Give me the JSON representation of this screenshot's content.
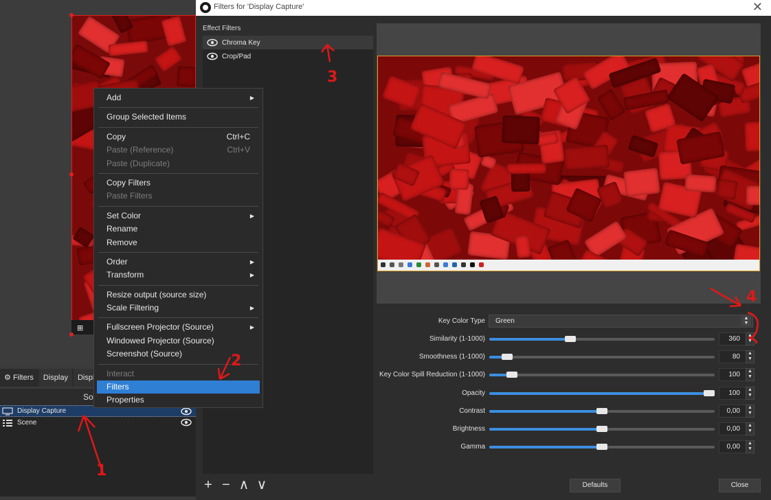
{
  "main": {
    "dock_tabs": [
      "Filters",
      "Display",
      "Displ"
    ],
    "sources_header": "Sou",
    "sources": [
      {
        "name": "Display Capture",
        "selected": true
      },
      {
        "name": "Scene",
        "selected": false
      }
    ]
  },
  "context_menu": {
    "items": [
      {
        "label": "Add",
        "submenu": true
      },
      {
        "sep": true
      },
      {
        "label": "Group Selected Items"
      },
      {
        "sep": true
      },
      {
        "label": "Copy",
        "shortcut": "Ctrl+C"
      },
      {
        "label": "Paste (Reference)",
        "shortcut": "Ctrl+V",
        "disabled": true
      },
      {
        "label": "Paste (Duplicate)",
        "disabled": true
      },
      {
        "sep": true
      },
      {
        "label": "Copy Filters"
      },
      {
        "label": "Paste Filters",
        "disabled": true
      },
      {
        "sep": true
      },
      {
        "label": "Set Color",
        "submenu": true
      },
      {
        "label": "Rename"
      },
      {
        "label": "Remove"
      },
      {
        "sep": true
      },
      {
        "label": "Order",
        "submenu": true
      },
      {
        "label": "Transform",
        "submenu": true
      },
      {
        "sep": true
      },
      {
        "label": "Resize output (source size)"
      },
      {
        "label": "Scale Filtering",
        "submenu": true
      },
      {
        "sep": true
      },
      {
        "label": "Fullscreen Projector (Source)",
        "submenu": true
      },
      {
        "label": "Windowed Projector (Source)"
      },
      {
        "label": "Screenshot (Source)"
      },
      {
        "sep": true
      },
      {
        "label": "Interact",
        "disabled": true
      },
      {
        "label": "Filters",
        "highlighted": true
      },
      {
        "label": "Properties"
      }
    ]
  },
  "dialog": {
    "title": "Filters for 'Display Capture'",
    "effect_filters_label": "Effect Filters",
    "filters": [
      {
        "name": "Chroma Key",
        "selected": true
      },
      {
        "name": "Crop/Pad",
        "selected": false
      }
    ],
    "list_tools": [
      "+",
      "−",
      "∧",
      "∨"
    ],
    "key_color_type": {
      "label": "Key Color Type",
      "value": "Green"
    },
    "properties": [
      {
        "label": "Similarity (1-1000)",
        "value": "360",
        "fraction": 0.36
      },
      {
        "label": "Smoothness (1-1000)",
        "value": "80",
        "fraction": 0.08
      },
      {
        "label": "Key Color Spill Reduction (1-1000)",
        "value": "100",
        "fraction": 0.1
      },
      {
        "label": "Opacity",
        "value": "100",
        "fraction": 1.0
      },
      {
        "label": "Contrast",
        "value": "0,00",
        "fraction": 0.5
      },
      {
        "label": "Brightness",
        "value": "0,00",
        "fraction": 0.5
      },
      {
        "label": "Gamma",
        "value": "0,00",
        "fraction": 0.5
      }
    ],
    "defaults_label": "Defaults",
    "close_label": "Close"
  },
  "annotations": [
    "1",
    "2",
    "3",
    "4"
  ],
  "colors": {
    "accent": "#2f7fd4",
    "slider_fill": "#3d8ee0",
    "annotation": "#e01818",
    "preview_red": "#8a0a0a"
  }
}
